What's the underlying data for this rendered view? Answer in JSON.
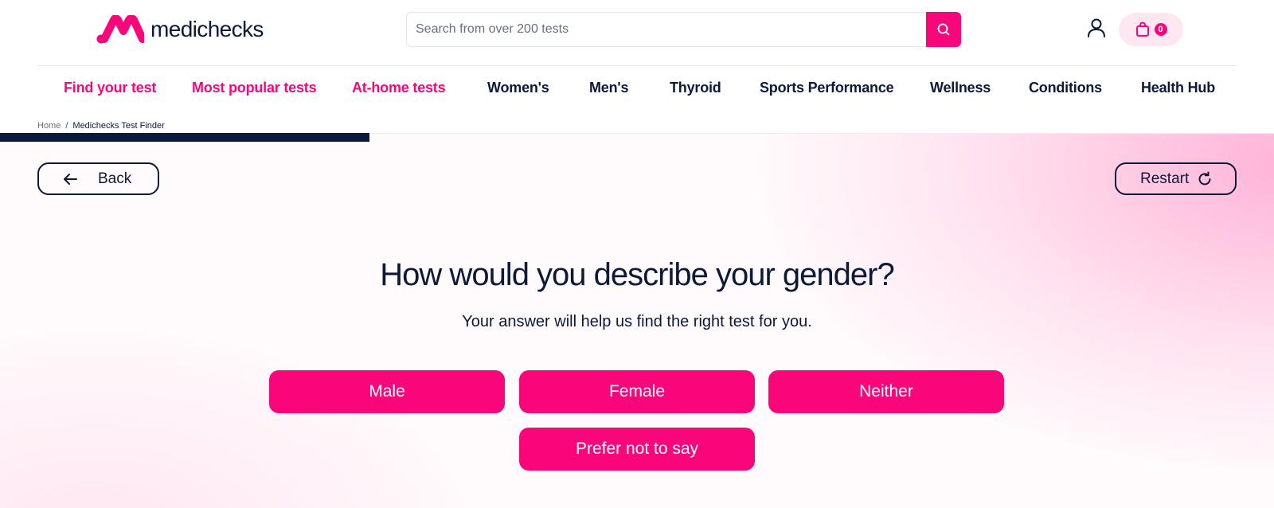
{
  "header": {
    "logo_text": "medichecks",
    "search_placeholder": "Search from over 200 tests",
    "cart_count": "0",
    "icons": {
      "search": "search-icon",
      "account": "user-icon",
      "cart": "shopping-bag-icon"
    }
  },
  "nav": {
    "items": [
      {
        "label": "Find your test",
        "color": "pink"
      },
      {
        "label": "Most popular tests",
        "color": "pink"
      },
      {
        "label": "At-home tests",
        "color": "pink"
      },
      {
        "label": "Women's",
        "color": "navy"
      },
      {
        "label": "Men's",
        "color": "navy"
      },
      {
        "label": "Thyroid",
        "color": "navy"
      },
      {
        "label": "Sports Performance",
        "color": "navy"
      },
      {
        "label": "Wellness",
        "color": "navy"
      },
      {
        "label": "Conditions",
        "color": "navy"
      },
      {
        "label": "Health Hub",
        "color": "navy"
      }
    ]
  },
  "breadcrumb": {
    "home": "Home",
    "separator": "/",
    "current": "Medichecks Test Finder"
  },
  "quiz": {
    "back_label": "Back",
    "restart_label": "Restart",
    "progress_fraction": 0.29,
    "question": "How would you describe your gender?",
    "subtitle": "Your answer will help us find the right test for you.",
    "options": [
      "Male",
      "Female",
      "Neither",
      "Prefer not to say"
    ]
  },
  "colors": {
    "brand_pink": "#f8067a",
    "navy": "#0b1a3a",
    "cart_bg": "#fde8f1"
  }
}
